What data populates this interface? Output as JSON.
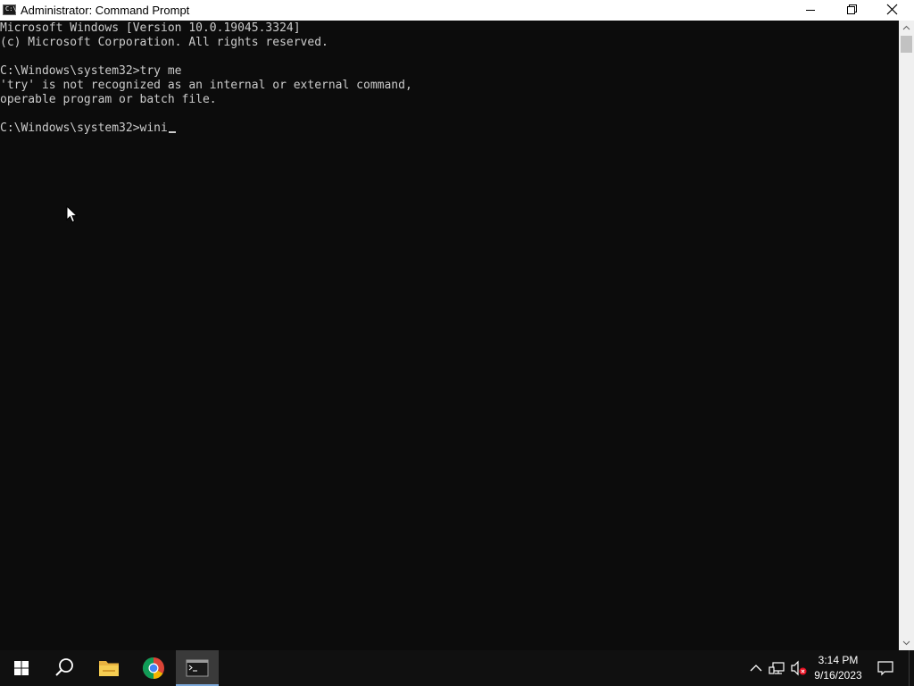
{
  "window": {
    "title": "Administrator: Command Prompt",
    "icon_label": "C:\\_"
  },
  "console": {
    "lines": [
      "Microsoft Windows [Version 10.0.19045.3324]",
      "(c) Microsoft Corporation. All rights reserved.",
      "",
      "C:\\Windows\\system32>try me",
      "'try' is not recognized as an internal or external command,",
      "operable program or batch file.",
      "",
      "C:\\Windows\\system32>wini"
    ]
  },
  "taskbar": {
    "pinned": [
      {
        "name": "start-icon"
      },
      {
        "name": "search-icon"
      },
      {
        "name": "file-explorer-icon"
      },
      {
        "name": "chrome-icon"
      },
      {
        "name": "command-prompt-icon",
        "active": true
      }
    ],
    "tray": {
      "icons": [
        "chevron-up-icon",
        "network-icon",
        "volume-muted-icon",
        "notification-icon"
      ]
    },
    "clock": {
      "time": "3:14 PM",
      "date": "9/16/2023"
    }
  },
  "colors": {
    "console_bg": "#0c0c0c",
    "console_fg": "#cccccc",
    "taskbar_bg": "#101010",
    "titlebar_bg": "#ffffff",
    "active_underline": "#7aa7d8"
  }
}
